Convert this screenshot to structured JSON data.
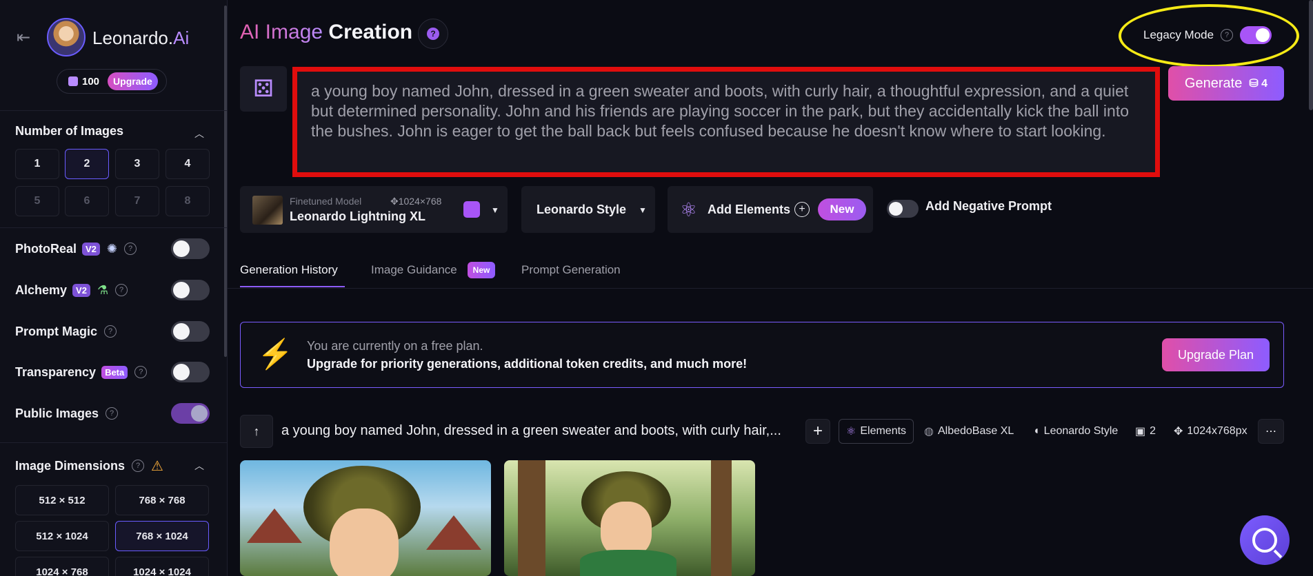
{
  "brand": {
    "name": "Leonardo.",
    "name_accent": "Ai"
  },
  "tokens": {
    "count": "100",
    "upgrade_label": "Upgrade"
  },
  "number_of_images": {
    "title": "Number of Images",
    "options": [
      "1",
      "2",
      "3",
      "4",
      "5",
      "6",
      "7",
      "8"
    ],
    "selected": "2"
  },
  "settings": {
    "photoreal": {
      "label": "PhotoReal",
      "badge": "V2"
    },
    "alchemy": {
      "label": "Alchemy",
      "badge": "V2"
    },
    "prompt_magic": {
      "label": "Prompt Magic"
    },
    "transparency": {
      "label": "Transparency",
      "badge": "Beta"
    },
    "public_images": {
      "label": "Public Images"
    }
  },
  "image_dimensions": {
    "title": "Image Dimensions",
    "options": [
      "512 × 512",
      "768 × 768",
      "512 × 1024",
      "768 × 1024",
      "1024 × 768",
      "1024 × 1024"
    ],
    "selected": "768 × 1024"
  },
  "header": {
    "title_accent": "AI Image",
    "title_main": "Creation",
    "legacy_label": "Legacy Mode"
  },
  "prompt": {
    "text": "a young boy named John, dressed in a green sweater and boots, with curly hair, a thoughtful expression, and a quiet but determined personality. John and his friends are playing soccer in the park, but they accidentally kick the ball into the bushes. John is eager to get the ball back but feels confused because he doesn't know where to start looking."
  },
  "generate": {
    "label": "Generate",
    "cost": "4"
  },
  "model": {
    "kicker": "Finetuned Model",
    "size": "1024×768",
    "name": "Leonardo Lightning XL"
  },
  "style": {
    "label": "Leonardo Style"
  },
  "elements": {
    "label": "Add Elements",
    "new_label": "New"
  },
  "negative": {
    "label": "Add Negative Prompt"
  },
  "tabs": [
    {
      "label": "Generation History"
    },
    {
      "label": "Image Guidance",
      "badge": "New"
    },
    {
      "label": "Prompt Generation"
    }
  ],
  "banner": {
    "line1": "You are currently on a free plan.",
    "line2": "Upgrade for priority generations, additional token credits, and much more!",
    "button": "Upgrade Plan"
  },
  "history": {
    "prompt": "a young boy named John, dressed in a green sweater and boots, with curly hair,...",
    "elements": "Elements",
    "model": "AlbedoBase XL",
    "style": "Leonardo Style",
    "count": "2",
    "size": "1024x768px"
  },
  "colors": {
    "accent": "#8d5cff",
    "pink": "#e04fa8",
    "highlight_red": "#e00d0d",
    "highlight_yellow": "#f5ea16"
  }
}
